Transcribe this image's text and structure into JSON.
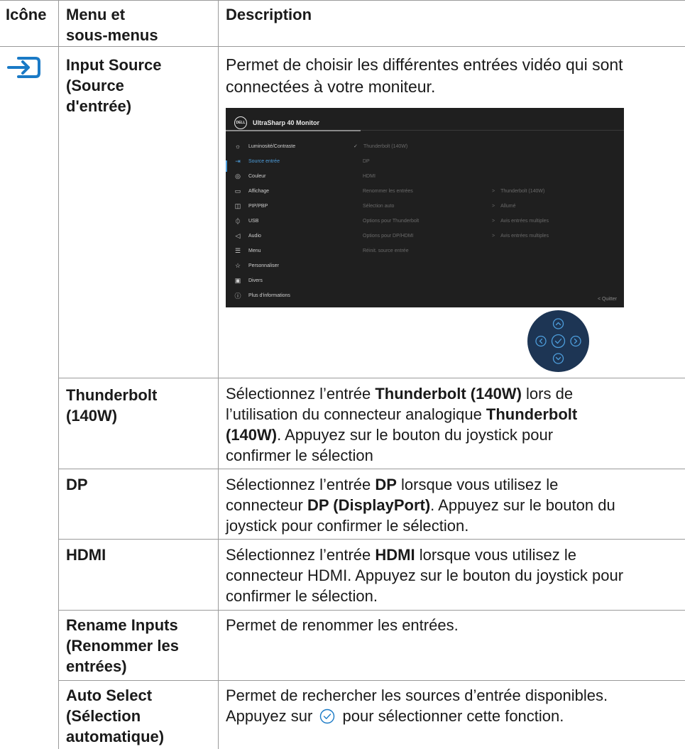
{
  "headers": {
    "icon": "Icône",
    "menu_line1": "Menu et",
    "menu_line2": "sous-menus",
    "description": "Description"
  },
  "icons": {
    "input_source": "input-source-icon",
    "select_inline": "check-circle-icon"
  },
  "colors": {
    "accent": "#1a7ac6",
    "osd_bg": "#1f1f1f",
    "osd_active": "#4d9ddb",
    "joystick_bg": "#1d3554"
  },
  "rows": {
    "input_source": {
      "menu_l1": "Input Source",
      "menu_l2": "(Source",
      "menu_l3": "d'entrée)",
      "desc_l1": "Permet de choisir les différentes entrées vidéo qui sont",
      "desc_l2": "connectées à votre moniteur."
    },
    "thunderbolt": {
      "menu_l1": "Thunderbolt",
      "menu_l2": "(140W)",
      "d1a": "Sélectionnez l’entrée ",
      "d1b": "Thunderbolt (140W)",
      "d1c": " lors de",
      "d2a": "l’utilisation du connecteur analogique ",
      "d2b": "Thunderbolt",
      "d3a": "(140W)",
      "d3b": ". Appuyez sur le bouton du joystick pour",
      "d4": "confirmer le sélection"
    },
    "dp": {
      "menu": "DP",
      "d1a": "Sélectionnez l’entrée ",
      "d1b": "DP",
      "d1c": " lorsque vous utilisez le",
      "d2a": "connecteur ",
      "d2b": "DP (DisplayPort)",
      "d2c": ". Appuyez sur le bouton du",
      "d3": "joystick pour confirmer le sélection."
    },
    "hdmi": {
      "menu": "HDMI",
      "d1a": "Sélectionnez l’entrée ",
      "d1b": "HDMI",
      "d1c": " lorsque vous utilisez le",
      "d2": "connecteur HDMI. Appuyez sur le bouton du joystick pour",
      "d3": "confirmer le sélection."
    },
    "rename": {
      "menu_l1": "Rename Inputs",
      "menu_l2": "(Renommer les",
      "menu_l3": "entrées)",
      "desc": "Permet de renommer les entrées."
    },
    "auto": {
      "menu_l1": "Auto Select",
      "menu_l2": "(Sélection",
      "menu_l3": "automatique)",
      "d1": "Permet de rechercher les sources d’entrée disponibles.",
      "d2a": "Appuyez sur ",
      "d2b": " pour sélectionner cette fonction."
    }
  },
  "osd": {
    "logo": "DELL",
    "title": "UltraSharp 40 Monitor",
    "menu_items": [
      {
        "label": "Luminosité/Contraste",
        "icon": "brightness-icon"
      },
      {
        "label": "Source entrée",
        "icon": "input-source-icon"
      },
      {
        "label": "Couleur",
        "icon": "palette-icon"
      },
      {
        "label": "Affichage",
        "icon": "display-icon"
      },
      {
        "label": "PIP/PBP",
        "icon": "pip-icon"
      },
      {
        "label": "USB",
        "icon": "usb-icon"
      },
      {
        "label": "Audio",
        "icon": "speaker-icon"
      },
      {
        "label": "Menu",
        "icon": "menu-icon"
      },
      {
        "label": "Personnaliser",
        "icon": "star-icon"
      },
      {
        "label": "Divers",
        "icon": "others-icon"
      },
      {
        "label": "Plus d'informations",
        "icon": "info-icon"
      }
    ],
    "submenu": [
      "Thunderbolt (140W)",
      "DP",
      "HDMI",
      "Renommer les entrées",
      "Sélection auto",
      "Options pour Thunderbolt",
      "Options pour DP/HDMI",
      "Réinit. source entrée"
    ],
    "values": [
      "Thunderbolt (140W)",
      "Allumé",
      "Avis entrées multiples",
      "Avis entrées multiples"
    ],
    "quit": "Quitter"
  }
}
